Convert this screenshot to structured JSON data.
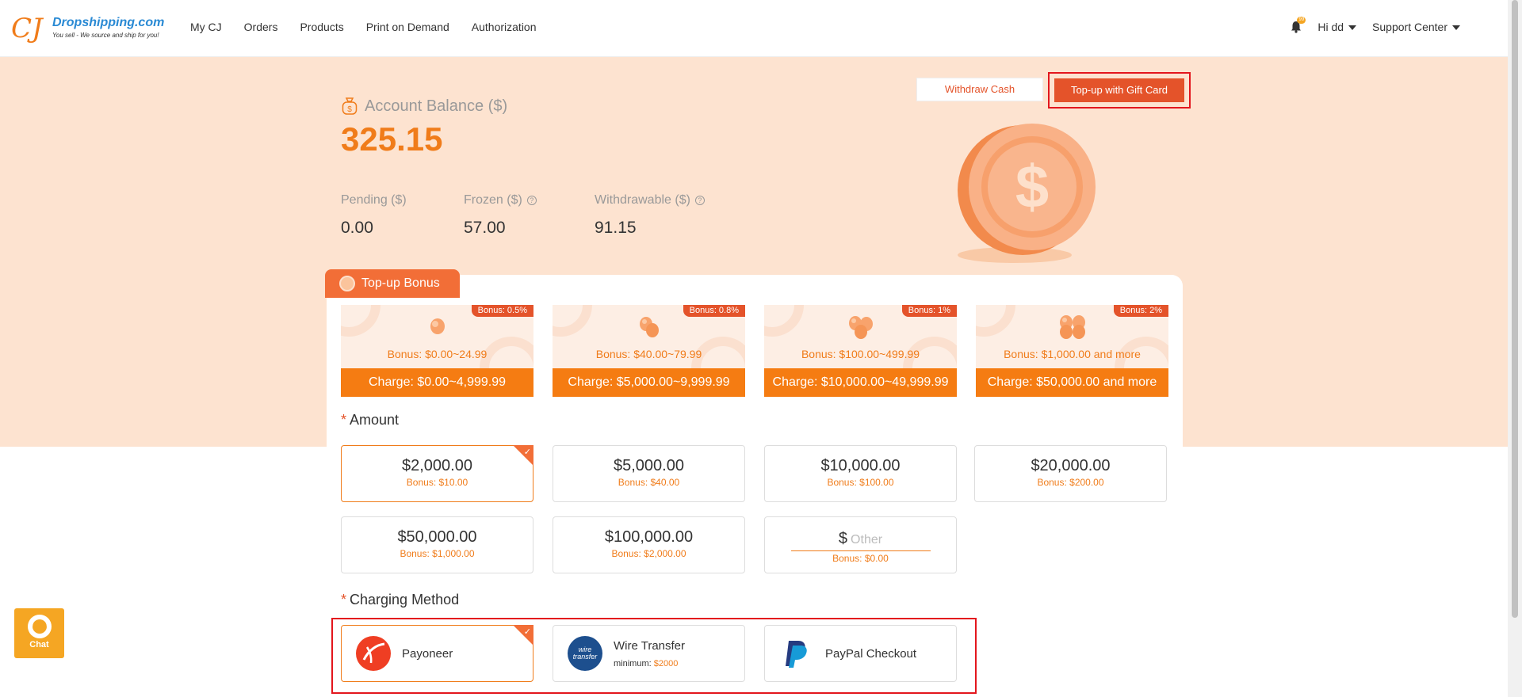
{
  "nav": {
    "logo": {
      "mark": "CJ",
      "brand": "Dropshipping.com",
      "tagline": "You sell - We source and ship for you!"
    },
    "menu": [
      "My CJ",
      "Orders",
      "Products",
      "Print on Demand",
      "Authorization"
    ],
    "notif_count": "99",
    "user": "Hi dd",
    "support": "Support Center"
  },
  "balance": {
    "label": "Account Balance ($)",
    "value": "325.15",
    "pending_label": "Pending ($)",
    "pending": "0.00",
    "frozen_label": "Frozen ($)",
    "frozen": "57.00",
    "withdrawable_label": "Withdrawable ($)",
    "withdrawable": "91.15"
  },
  "actions": {
    "withdraw": "Withdraw Cash",
    "topup_gift": "Top-up with Gift Card"
  },
  "bonus_tab": "Top-up Bonus",
  "tiers": [
    {
      "badge": "Bonus: 0.5%",
      "bonus": "Bonus: $0.00~24.99",
      "charge": "Charge: $0.00~4,999.99",
      "eggs": 1
    },
    {
      "badge": "Bonus: 0.8%",
      "bonus": "Bonus: $40.00~79.99",
      "charge": "Charge: $5,000.00~9,999.99",
      "eggs": 2
    },
    {
      "badge": "Bonus: 1%",
      "bonus": "Bonus: $100.00~499.99",
      "charge": "Charge: $10,000.00~49,999.99",
      "eggs": 3
    },
    {
      "badge": "Bonus: 2%",
      "bonus": "Bonus: $1,000.00 and more",
      "charge": "Charge: $50,000.00 and more",
      "eggs": 4
    }
  ],
  "amount_title": "Amount",
  "amounts": [
    {
      "value": "$2,000.00",
      "bonus": "Bonus: $10.00",
      "selected": true
    },
    {
      "value": "$5,000.00",
      "bonus": "Bonus: $40.00"
    },
    {
      "value": "$10,000.00",
      "bonus": "Bonus: $100.00"
    },
    {
      "value": "$20,000.00",
      "bonus": "Bonus: $200.00"
    },
    {
      "value": "$50,000.00",
      "bonus": "Bonus: $1,000.00"
    },
    {
      "value": "$100,000.00",
      "bonus": "Bonus: $2,000.00"
    }
  ],
  "other": {
    "currency": "$",
    "placeholder": "Other",
    "bonus": "Bonus: $0.00"
  },
  "method_title": "Charging Method",
  "methods": {
    "payoneer": "Payoneer",
    "wire": "Wire Transfer",
    "wire_min_label": "minimum:",
    "wire_min_value": "$2000",
    "wire_logo_text": "wire transfer",
    "paypal": "PayPal Checkout"
  },
  "chat": "Chat",
  "colors": {
    "accent": "#f07c1a",
    "accent_dark": "#e4532a",
    "hero_bg": "#fde3d0",
    "highlight": "#e3161d"
  }
}
